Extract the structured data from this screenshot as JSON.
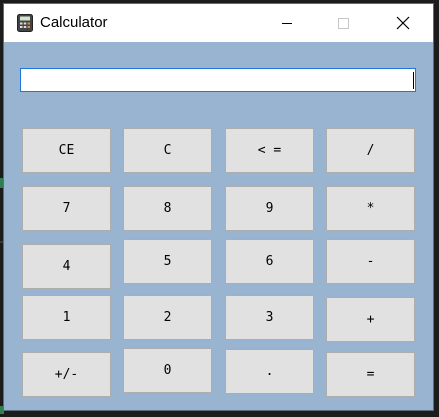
{
  "window": {
    "title": "Calculator",
    "controls": {
      "minimize": "minimize",
      "maximize": "maximize",
      "close": "close"
    }
  },
  "display": {
    "value": ""
  },
  "keys": {
    "ce": "CE",
    "c": "C",
    "backspace": "< =",
    "divide": "/",
    "seven": "7",
    "eight": "8",
    "nine": "9",
    "multiply": "*",
    "four": "4",
    "five": "5",
    "six": "6",
    "minus": "-",
    "one": "1",
    "two": "2",
    "three": "3",
    "plus": "+",
    "negate": "+/-",
    "zero": "0",
    "decimal": ".",
    "equals": "="
  },
  "colors": {
    "client_bg": "#99b4d1",
    "titlebar_bg": "#ffffff",
    "button_face": "#e1e1e1",
    "button_border": "#adadad",
    "display_border": "#1e78d7"
  },
  "icons": {
    "app": "calculator-icon"
  }
}
